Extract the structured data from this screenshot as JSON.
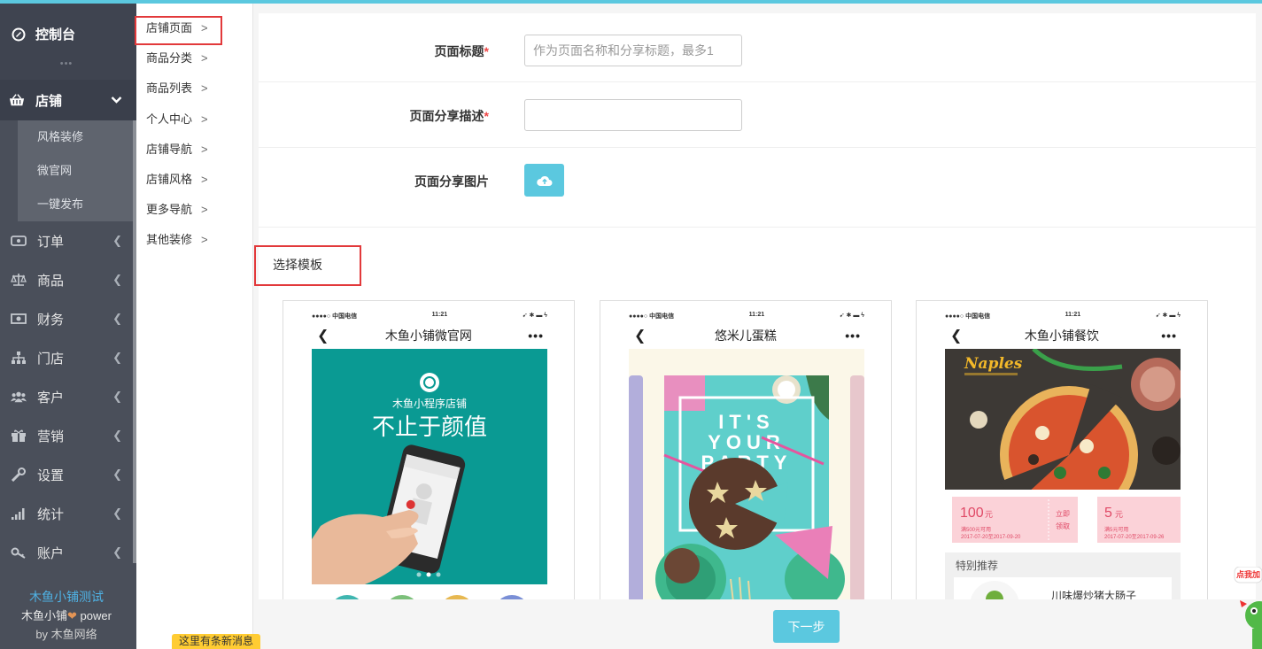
{
  "sidebar": {
    "dashboard": "控制台",
    "dots": "•••",
    "shop": "店铺",
    "shop_sub": [
      "风格装修",
      "微官网",
      "一键发布"
    ],
    "items": [
      {
        "label": "订单",
        "icon": "order-icon"
      },
      {
        "label": "商品",
        "icon": "scale-icon"
      },
      {
        "label": "财务",
        "icon": "money-icon"
      },
      {
        "label": "门店",
        "icon": "sitemap-icon"
      },
      {
        "label": "客户",
        "icon": "users-icon"
      },
      {
        "label": "营销",
        "icon": "gift-icon"
      },
      {
        "label": "设置",
        "icon": "wrench-icon"
      },
      {
        "label": "统计",
        "icon": "signal-icon"
      },
      {
        "label": "账户",
        "icon": "key-icon"
      }
    ],
    "footer": {
      "shop_name": "木鱼小铺测试",
      "power_prefix": "木鱼小铺",
      "power_suffix": " power",
      "by": "by 木鱼网络"
    }
  },
  "subnav": [
    "店铺页面",
    "商品分类",
    "商品列表",
    "个人中心",
    "店铺导航",
    "店铺风格",
    "更多导航",
    "其他装修"
  ],
  "form": {
    "title_label": "页面标题",
    "title_placeholder": "作为页面名称和分享标题，最多1",
    "desc_label": "页面分享描述",
    "image_label": "页面分享图片",
    "required_mark": "*"
  },
  "templates": {
    "section_title": "选择模板",
    "cards": [
      {
        "title": "木鱼小铺微官网",
        "carrier": "●●●●○ 中国电信",
        "time": "11:21",
        "hero_sub": "木鱼小程序店铺",
        "hero_main": "不止于颜值"
      },
      {
        "title": "悠米儿蛋糕",
        "carrier": "●●●●○ 中国电信",
        "time": "11:21",
        "poster": "IT'S YOUR PARTY"
      },
      {
        "title": "木鱼小铺餐饮",
        "carrier": "●●●●○ 中国电信",
        "time": "11:21",
        "brand": "Naples",
        "coupon1_value": "100",
        "coupon1_unit": "元",
        "coupon1_rule": "满500元可用",
        "coupon1_date": "2017-07-20至2017-09-20",
        "coupon_btn": "立即领取",
        "coupon2_value": "5",
        "coupon2_unit": "元",
        "coupon2_rule": "满5元可用",
        "coupon2_date": "2017-07-20至2017-09-26",
        "section": "特别推荐",
        "dish": "川味爆炒猪大肠子"
      }
    ]
  },
  "actions": {
    "next": "下一步"
  },
  "notice": {
    "message": "这里有条新消息",
    "mascot_text": "点我加"
  }
}
